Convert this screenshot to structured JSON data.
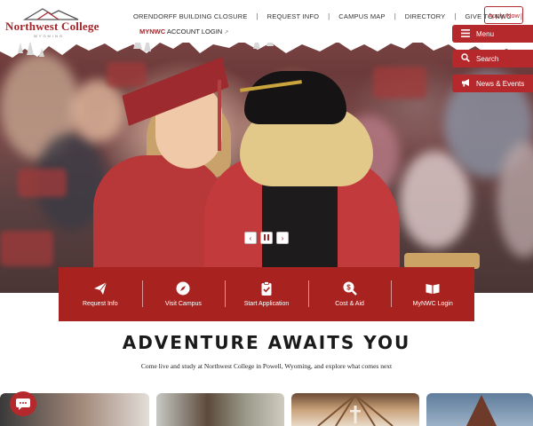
{
  "brand": {
    "name": "Northwest College",
    "tagline": "WYOMING",
    "accent_color": "#a8231f"
  },
  "utility_nav": [
    {
      "label": "ORENDORFF BUILDING CLOSURE"
    },
    {
      "label": "REQUEST INFO"
    },
    {
      "label": "CAMPUS MAP"
    },
    {
      "label": "DIRECTORY"
    },
    {
      "label": "GIVE TO NWC"
    }
  ],
  "apply_button": {
    "label": "Apply Now"
  },
  "account_link": {
    "prefix": "MYNWC",
    "label": " ACCOUNT LOGIN",
    "icon": "external-link-icon"
  },
  "side_buttons": [
    {
      "label": "Menu",
      "icon": "menu-icon"
    },
    {
      "label": "Search",
      "icon": "search-icon"
    },
    {
      "label": "News & Events",
      "icon": "megaphone-icon"
    }
  ],
  "carousel": {
    "prev_icon": "chevron-left-icon",
    "pause_icon": "pause-icon",
    "next_icon": "chevron-right-icon"
  },
  "quick_links": [
    {
      "label": "Request Info",
      "icon": "paper-plane-icon"
    },
    {
      "label": "Visit Campus",
      "icon": "compass-icon"
    },
    {
      "label": "Start Application",
      "icon": "clipboard-check-icon"
    },
    {
      "label": "Cost & Aid",
      "icon": "money-search-icon"
    },
    {
      "label": "MyNWC Login",
      "icon": "book-open-icon"
    }
  ],
  "main": {
    "headline": "ADVENTURE AWAITS YOU",
    "subline": "Come live and study at Northwest College in Powell, Wyoming, and explore what comes next"
  },
  "chat": {
    "icon": "chat-icon"
  }
}
